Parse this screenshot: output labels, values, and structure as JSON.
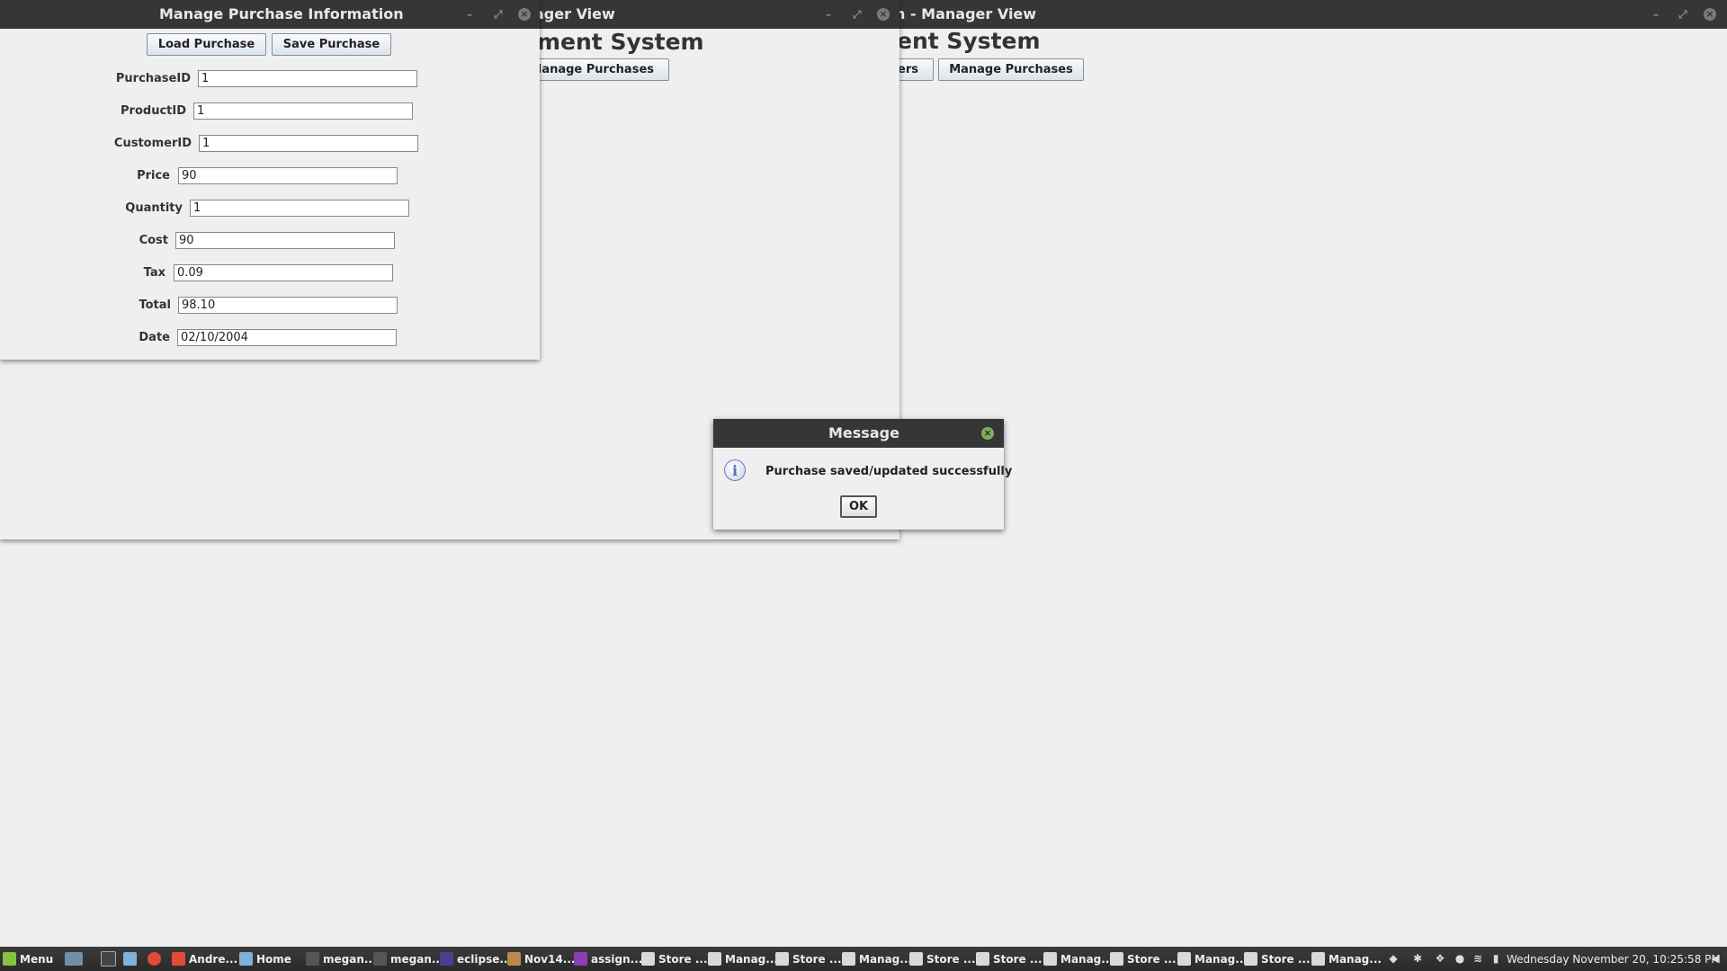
{
  "window_back": {
    "title": "n - Manager View",
    "heading": "ent System",
    "buttons": [
      "ers",
      "Manage Purchases"
    ],
    "controls": {
      "minimize": "–",
      "maximize": "⤢",
      "close": "×"
    }
  },
  "window_middle": {
    "title": "ager View",
    "heading": "ment System",
    "buttons": [
      "Manage Purchases"
    ],
    "controls": {
      "minimize": "–",
      "maximize": "⤢",
      "close": "×"
    }
  },
  "purchase_window": {
    "title": "Manage Purchase Information",
    "controls": {
      "minimize": "–",
      "maximize": "⤢",
      "close": "×"
    },
    "load_button": "Load Purchase",
    "save_button": "Save Purchase",
    "fields": [
      {
        "label": "PurchaseID",
        "value": "1"
      },
      {
        "label": "ProductID",
        "value": "1"
      },
      {
        "label": "CustomerID",
        "value": "1"
      },
      {
        "label": "Price",
        "value": "90"
      },
      {
        "label": "Quantity",
        "value": "1"
      },
      {
        "label": "Cost",
        "value": "90"
      },
      {
        "label": "Tax",
        "value": "0.09"
      },
      {
        "label": "Total",
        "value": "98.10"
      },
      {
        "label": "Date",
        "value": "02/10/2004"
      }
    ]
  },
  "dialog": {
    "title": "Message",
    "icon": "info-icon",
    "message": "Purchase saved/updated successfully",
    "ok_button": "OK",
    "close": "×"
  },
  "taskbar": {
    "menu_label": "Menu",
    "items": [
      {
        "label": "Andre...",
        "icon": "chrome-icon",
        "color": "#e04b3a"
      },
      {
        "label": "Home",
        "icon": "folder-icon",
        "color": "#7fb2d9"
      },
      {
        "label": "megan...",
        "icon": "terminal-icon",
        "color": "#555555"
      },
      {
        "label": "megan...",
        "icon": "terminal-icon",
        "color": "#555555"
      },
      {
        "label": "eclipse...",
        "icon": "eclipse-icon",
        "color": "#4b3f8f"
      },
      {
        "label": "Nov14....",
        "icon": "archive-icon",
        "color": "#b98a4a"
      },
      {
        "label": "assign...",
        "icon": "ide-icon",
        "color": "#8a3fb5"
      },
      {
        "label": "Store ...",
        "icon": "java-icon",
        "color": "#d9d9d9"
      },
      {
        "label": "Manag...",
        "icon": "java-icon",
        "color": "#d9d9d9"
      },
      {
        "label": "Store ...",
        "icon": "java-icon",
        "color": "#d9d9d9"
      },
      {
        "label": "Manag...",
        "icon": "java-icon",
        "color": "#d9d9d9"
      },
      {
        "label": "Store ...",
        "icon": "java-icon",
        "color": "#d9d9d9"
      },
      {
        "label": "Store ...",
        "icon": "java-icon",
        "color": "#d9d9d9"
      },
      {
        "label": "Manag...",
        "icon": "java-icon",
        "color": "#d9d9d9"
      },
      {
        "label": "Store ...",
        "icon": "java-icon",
        "color": "#d9d9d9"
      },
      {
        "label": "Manag...",
        "icon": "java-icon",
        "color": "#d9d9d9"
      },
      {
        "label": "Store ...",
        "icon": "java-icon",
        "color": "#d9d9d9"
      },
      {
        "label": "Manag...",
        "icon": "java-icon",
        "color": "#d9d9d9"
      }
    ],
    "clock": "Wednesday November 20, 10:25:58 PM"
  }
}
